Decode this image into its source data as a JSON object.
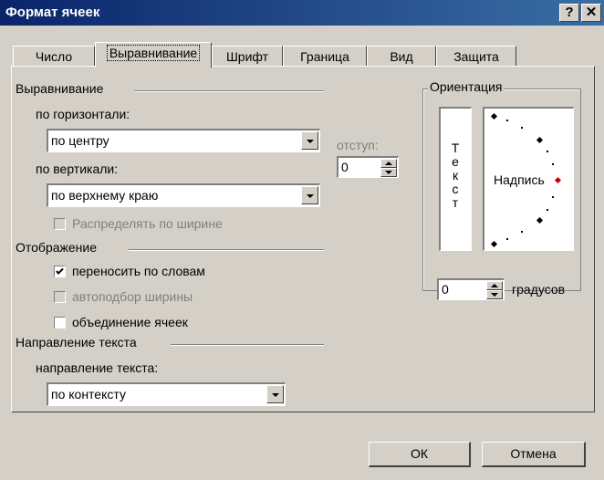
{
  "window": {
    "title": "Формат ячеек",
    "help_label": "?",
    "close_label": "✕"
  },
  "tabs": [
    {
      "label": "Число"
    },
    {
      "label": "Выравнивание",
      "active": true
    },
    {
      "label": "Шрифт"
    },
    {
      "label": "Граница"
    },
    {
      "label": "Вид"
    },
    {
      "label": "Защита"
    }
  ],
  "alignment": {
    "group_label": "Выравнивание",
    "horizontal_label": "по горизонтали:",
    "horizontal_value": "по центру",
    "vertical_label": "по вертикали:",
    "vertical_value": "по верхнему краю",
    "indent_label": "отступ:",
    "indent_value": "0",
    "distribute_label": "Распределять по ширине"
  },
  "display": {
    "group_label": "Отображение",
    "wrap_label": "переносить по словам",
    "wrap_checked": true,
    "shrink_label": "автоподбор ширины",
    "merge_label": "объединение ячеек",
    "merge_checked": false
  },
  "direction": {
    "group_label": "Направление текста",
    "field_label": "направление текста:",
    "value": "по контексту"
  },
  "orientation": {
    "group_label": "Ориентация",
    "vertical_text": [
      "Т",
      "е",
      "к",
      "с",
      "т"
    ],
    "sample_label": "Надпись",
    "degrees_value": "0",
    "degrees_label": "градусов",
    "marker_color": "#cc0000"
  },
  "buttons": {
    "ok_label": "ОК",
    "cancel_label": "Отмена"
  }
}
